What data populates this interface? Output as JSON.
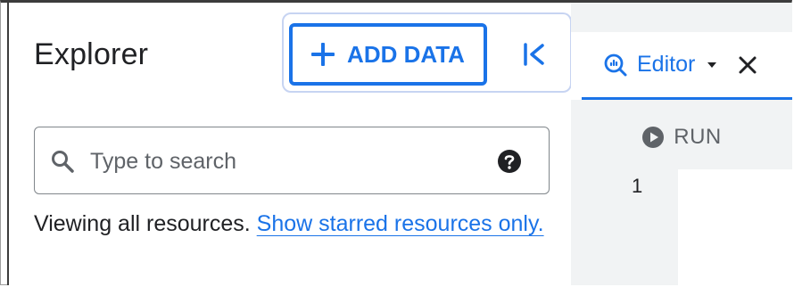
{
  "explorer": {
    "title": "Explorer",
    "add_data_label": "ADD DATA",
    "search": {
      "placeholder": "Type to search",
      "value": ""
    },
    "viewing_text": "Viewing all resources.",
    "starred_link": "Show starred resources only."
  },
  "editor": {
    "tab_label": "Editor",
    "run_label": "RUN",
    "line_numbers": [
      "1"
    ]
  },
  "colors": {
    "accent": "#1a73e8",
    "panel_bg": "#f1f3f4",
    "icon_dark": "#202124",
    "icon_gray": "#5f6368"
  },
  "icons": [
    "plus-icon",
    "collapse-panel-icon",
    "search-icon",
    "help-icon",
    "editor-tab-icon",
    "chevron-down-icon",
    "close-icon",
    "run-icon"
  ]
}
